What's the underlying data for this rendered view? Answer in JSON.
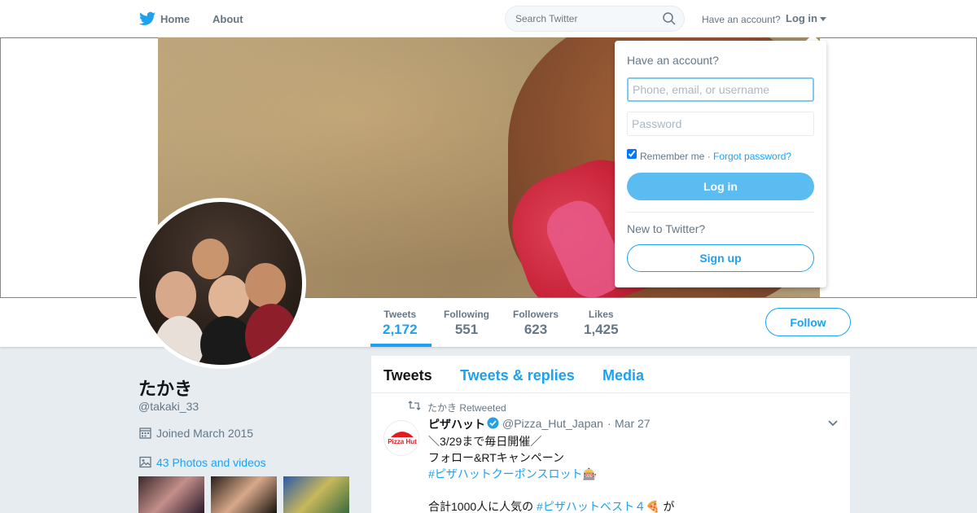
{
  "topnav": {
    "home_label": "Home",
    "about_label": "About",
    "search_placeholder": "Search Twitter",
    "have_account": "Have an account?",
    "login_label": "Log in"
  },
  "profile": {
    "fullname": "たかき",
    "screenname": "@takaki_33",
    "joined": "Joined March 2015",
    "photos_link": "43 Photos and videos"
  },
  "stats": [
    {
      "label": "Tweets",
      "value": "2,172"
    },
    {
      "label": "Following",
      "value": "551"
    },
    {
      "label": "Followers",
      "value": "623"
    },
    {
      "label": "Likes",
      "value": "1,425"
    }
  ],
  "follow_label": "Follow",
  "timeline": {
    "tabs": [
      "Tweets",
      "Tweets & replies",
      "Media"
    ],
    "retweet_label": "たかき Retweeted",
    "tweet": {
      "name": "ピザハット",
      "handle": "@Pizza_Hut_Japan",
      "dot": "·",
      "date": "Mar 27",
      "avatar_text": "Pizza Hut",
      "lines": [
        {
          "text": "＼3/29まで毎日開催／"
        },
        {
          "text": "フォロー&RTキャンペーン"
        },
        {
          "hashtag": "#ピザハットクーポンスロット",
          "emoji": "🎰"
        },
        {
          "prefix": "合計1000人に人気の ",
          "hashtag": "#ピザハットベスト４",
          "emoji": "🍕",
          "suffix": " が"
        }
      ]
    }
  },
  "login_dropdown": {
    "title": "Have an account?",
    "username_placeholder": "Phone, email, or username",
    "password_placeholder": "Password",
    "remember_me": "Remember me",
    "separator": " · ",
    "forgot_password": "Forgot password?",
    "login_button": "Log in",
    "new_to_twitter": "New to Twitter?",
    "signup_button": "Sign up"
  },
  "colors": {
    "accent": "#1da1f2",
    "login_button": "#5bbcf2",
    "background": "#e6ecf0",
    "muted_text": "#657786"
  }
}
